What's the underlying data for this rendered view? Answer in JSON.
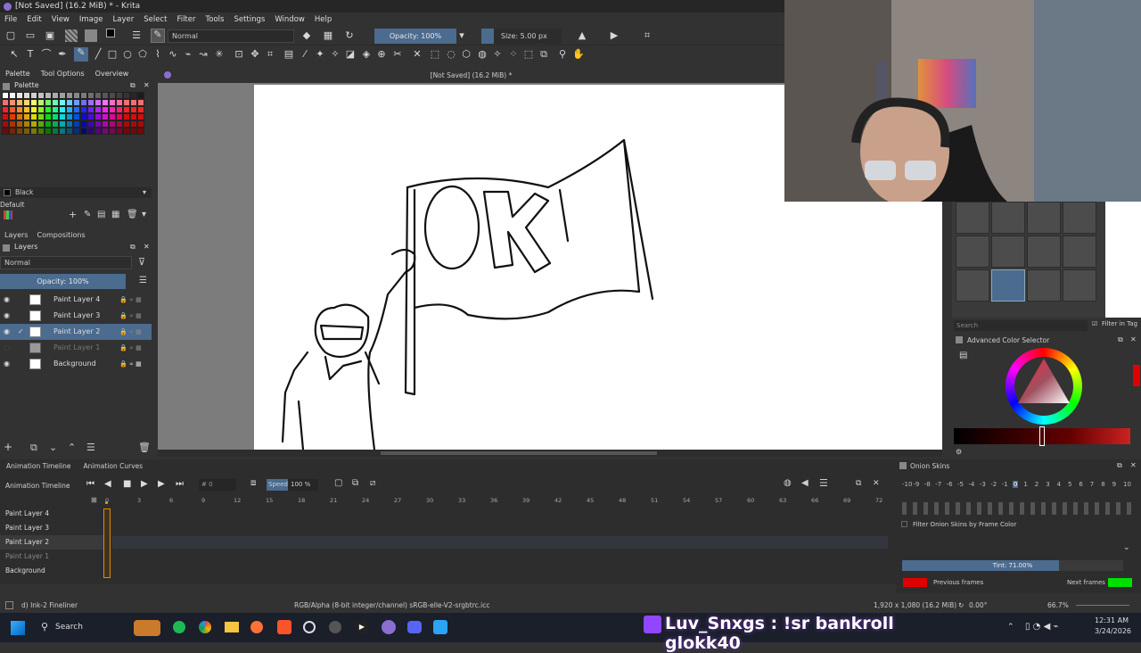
{
  "window": {
    "title": "[Not Saved]  (16.2 MiB) * - Krita"
  },
  "menu": [
    "File",
    "Edit",
    "View",
    "Image",
    "Layer",
    "Select",
    "Filter",
    "Tools",
    "Settings",
    "Window",
    "Help"
  ],
  "toolbar": {
    "blend_mode": "Normal",
    "opacity": "Opacity: 100%",
    "size": "Size: 5.00 px"
  },
  "dock_tabs": [
    "Palette",
    "Tool Options",
    "Overview"
  ],
  "palette": {
    "title": "Palette",
    "current_color": "Black",
    "palette_name": "Default"
  },
  "layers_panel": {
    "tabs": [
      "Layers",
      "Compositions"
    ],
    "blend_mode": "Normal",
    "opacity": "Opacity:  100%",
    "layers": [
      {
        "name": "Paint Layer 4"
      },
      {
        "name": "Paint Layer 3"
      },
      {
        "name": "Paint Layer 2"
      },
      {
        "name": "Paint Layer 1"
      },
      {
        "name": "Background"
      }
    ]
  },
  "document": {
    "tab_title": "[Not Saved]  (16.2 MiB) *"
  },
  "brush_presets": {
    "search_placeholder": "Search",
    "filter_label": "Filter in Tag"
  },
  "color_selector": {
    "title": "Advanced Color Selector"
  },
  "animation": {
    "tabs": [
      "Animation Timeline",
      "Animation Curves"
    ],
    "title": "Animation Timeline",
    "frame": "# 0",
    "speed_label": "Speed:",
    "speed_value": "100 %",
    "ticks": [
      "0",
      "3",
      "6",
      "9",
      "12",
      "15",
      "18",
      "21",
      "24",
      "27",
      "30",
      "33",
      "36",
      "39",
      "42",
      "45",
      "48",
      "51",
      "54",
      "57",
      "60",
      "63",
      "66",
      "69",
      "72"
    ],
    "layers": [
      "Paint Layer 4",
      "Paint Layer 3",
      "Paint Layer 2",
      "Paint Layer 1",
      "Background"
    ]
  },
  "onion_skins": {
    "title": "Onion Skins",
    "numbers": [
      "-10",
      "-9",
      "-8",
      "-7",
      "-6",
      "-5",
      "-4",
      "-3",
      "-2",
      "-1",
      "0",
      "1",
      "2",
      "3",
      "4",
      "5",
      "6",
      "7",
      "8",
      "9",
      "10"
    ],
    "filter_label": "Filter Onion Skins by Frame Color",
    "tint": "Tint: 71.00%",
    "tint_value": 0.71,
    "previous_frames": "Previous frames",
    "next_frames": "Next frames",
    "prev_color": "#e00000",
    "next_color": "#00e000"
  },
  "status": {
    "brush": "d) Ink-2 Fineliner",
    "color_info": "RGB/Alpha (8-bit integer/channel)  sRGB-elle-V2-srgbtrc.icc",
    "dims": "1,920 x 1,080 (16.2 MiB)",
    "rotation": "0.00°",
    "zoom": "66.7%"
  },
  "stream_overlay": {
    "text": "Luv_Snxgs : !sr bankroll glokk40"
  },
  "taskbar": {
    "search": "Search",
    "time": "12:31 AM",
    "date": "3/24/2026"
  },
  "colors": {
    "accent": "#4b6b8f",
    "panel": "#323232",
    "twitch_purple": "#9146ff"
  }
}
